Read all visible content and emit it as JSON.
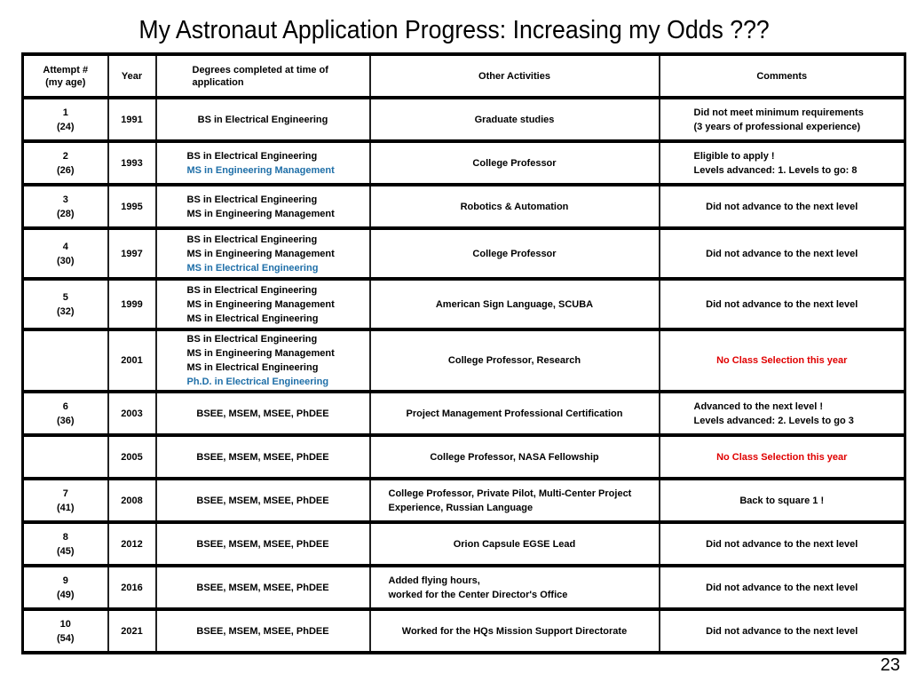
{
  "slide": {
    "title": "My Astronaut Application Progress: Increasing my Odds ???",
    "page_number": "23"
  },
  "colors": {
    "new_degree_highlight": "#1f6fa8",
    "no_selection_alert": "#e00000",
    "text": "#000000"
  },
  "table": {
    "headers": {
      "attempt_line1": "Attempt #",
      "attempt_line2": "(my age)",
      "year": "Year",
      "degrees_line1": "Degrees completed at time of",
      "degrees_line2": "application",
      "activities": "Other Activities",
      "comments": "Comments"
    },
    "rows": [
      {
        "attempt": "1",
        "age": "(24)",
        "year": "1991",
        "degrees": [
          {
            "text": "BS in Electrical Engineering",
            "new": false
          }
        ],
        "activities": [
          "Graduate studies"
        ],
        "comments": [
          "Did not meet minimum requirements",
          "(3 years of professional experience)"
        ],
        "comment_alert": false
      },
      {
        "attempt": "2",
        "age": "(26)",
        "year": "1993",
        "degrees": [
          {
            "text": "BS in Electrical Engineering",
            "new": false
          },
          {
            "text": "MS in Engineering Management",
            "new": true
          }
        ],
        "activities": [
          "College Professor"
        ],
        "comments": [
          "Eligible to apply !",
          "Levels advanced: 1.  Levels to go: 8"
        ],
        "comment_alert": false
      },
      {
        "attempt": "3",
        "age": "(28)",
        "year": "1995",
        "degrees": [
          {
            "text": "BS in Electrical Engineering",
            "new": false
          },
          {
            "text": "MS in Engineering Management",
            "new": false
          }
        ],
        "activities": [
          "Robotics & Automation"
        ],
        "comments": [
          "Did not advance to the next level"
        ],
        "comment_alert": false
      },
      {
        "attempt": "4",
        "age": "(30)",
        "year": "1997",
        "degrees": [
          {
            "text": "BS in Electrical Engineering",
            "new": false
          },
          {
            "text": "MS in Engineering Management",
            "new": false
          },
          {
            "text": "MS in Electrical Engineering",
            "new": true
          }
        ],
        "activities": [
          "College Professor"
        ],
        "comments": [
          "Did not advance to the next level"
        ],
        "comment_alert": false
      },
      {
        "attempt": "5",
        "age": "(32)",
        "year": "1999",
        "degrees": [
          {
            "text": "BS in Electrical Engineering",
            "new": false
          },
          {
            "text": "MS in Engineering Management",
            "new": false
          },
          {
            "text": "MS in Electrical Engineering",
            "new": false
          }
        ],
        "activities": [
          "American Sign Language, SCUBA"
        ],
        "comments": [
          "Did not advance to the next level"
        ],
        "comment_alert": false
      },
      {
        "attempt": "",
        "age": "",
        "year": "2001",
        "degrees": [
          {
            "text": "BS in Electrical Engineering",
            "new": false
          },
          {
            "text": "MS in Engineering Management",
            "new": false
          },
          {
            "text": "MS in Electrical Engineering",
            "new": false
          },
          {
            "text": "Ph.D. in Electrical Engineering",
            "new": true
          }
        ],
        "activities": [
          "College Professor, Research"
        ],
        "comments": [
          "No Class Selection this year"
        ],
        "comment_alert": true
      },
      {
        "attempt": "6",
        "age": "(36)",
        "year": "2003",
        "degrees": [
          {
            "text": "BSEE, MSEM, MSEE, PhDEE",
            "new": false
          }
        ],
        "activities": [
          "Project Management Professional Certification"
        ],
        "comments": [
          "Advanced to the next level !",
          "Levels advanced: 2.  Levels to go 3"
        ],
        "comment_alert": false
      },
      {
        "attempt": "",
        "age": "",
        "year": "2005",
        "degrees": [
          {
            "text": "BSEE, MSEM, MSEE, PhDEE",
            "new": false
          }
        ],
        "activities": [
          "College Professor, NASA Fellowship"
        ],
        "comments": [
          "No Class Selection this year"
        ],
        "comment_alert": true
      },
      {
        "attempt": "7",
        "age": "(41)",
        "year": "2008",
        "degrees": [
          {
            "text": "BSEE, MSEM, MSEE, PhDEE",
            "new": false
          }
        ],
        "activities": [
          "College Professor, Private Pilot, Multi-Center Project",
          "Experience, Russian Language"
        ],
        "comments": [
          "Back to square 1 !"
        ],
        "comment_alert": false
      },
      {
        "attempt": "8",
        "age": "(45)",
        "year": "2012",
        "degrees": [
          {
            "text": "BSEE, MSEM, MSEE, PhDEE",
            "new": false
          }
        ],
        "activities": [
          "Orion Capsule EGSE Lead"
        ],
        "comments": [
          "Did not advance to the next level"
        ],
        "comment_alert": false
      },
      {
        "attempt": "9",
        "age": "(49)",
        "year": "2016",
        "degrees": [
          {
            "text": "BSEE, MSEM, MSEE, PhDEE",
            "new": false
          }
        ],
        "activities": [
          "Added flying hours,",
          "worked for the Center Director's Office"
        ],
        "comments": [
          "Did not advance to the next level"
        ],
        "comment_alert": false
      },
      {
        "attempt": "10",
        "age": "(54)",
        "year": "2021",
        "degrees": [
          {
            "text": "BSEE, MSEM, MSEE, PhDEE",
            "new": false
          }
        ],
        "activities": [
          "Worked for the HQs Mission Support Directorate"
        ],
        "comments": [
          "Did not advance to the next level"
        ],
        "comment_alert": false
      }
    ]
  }
}
